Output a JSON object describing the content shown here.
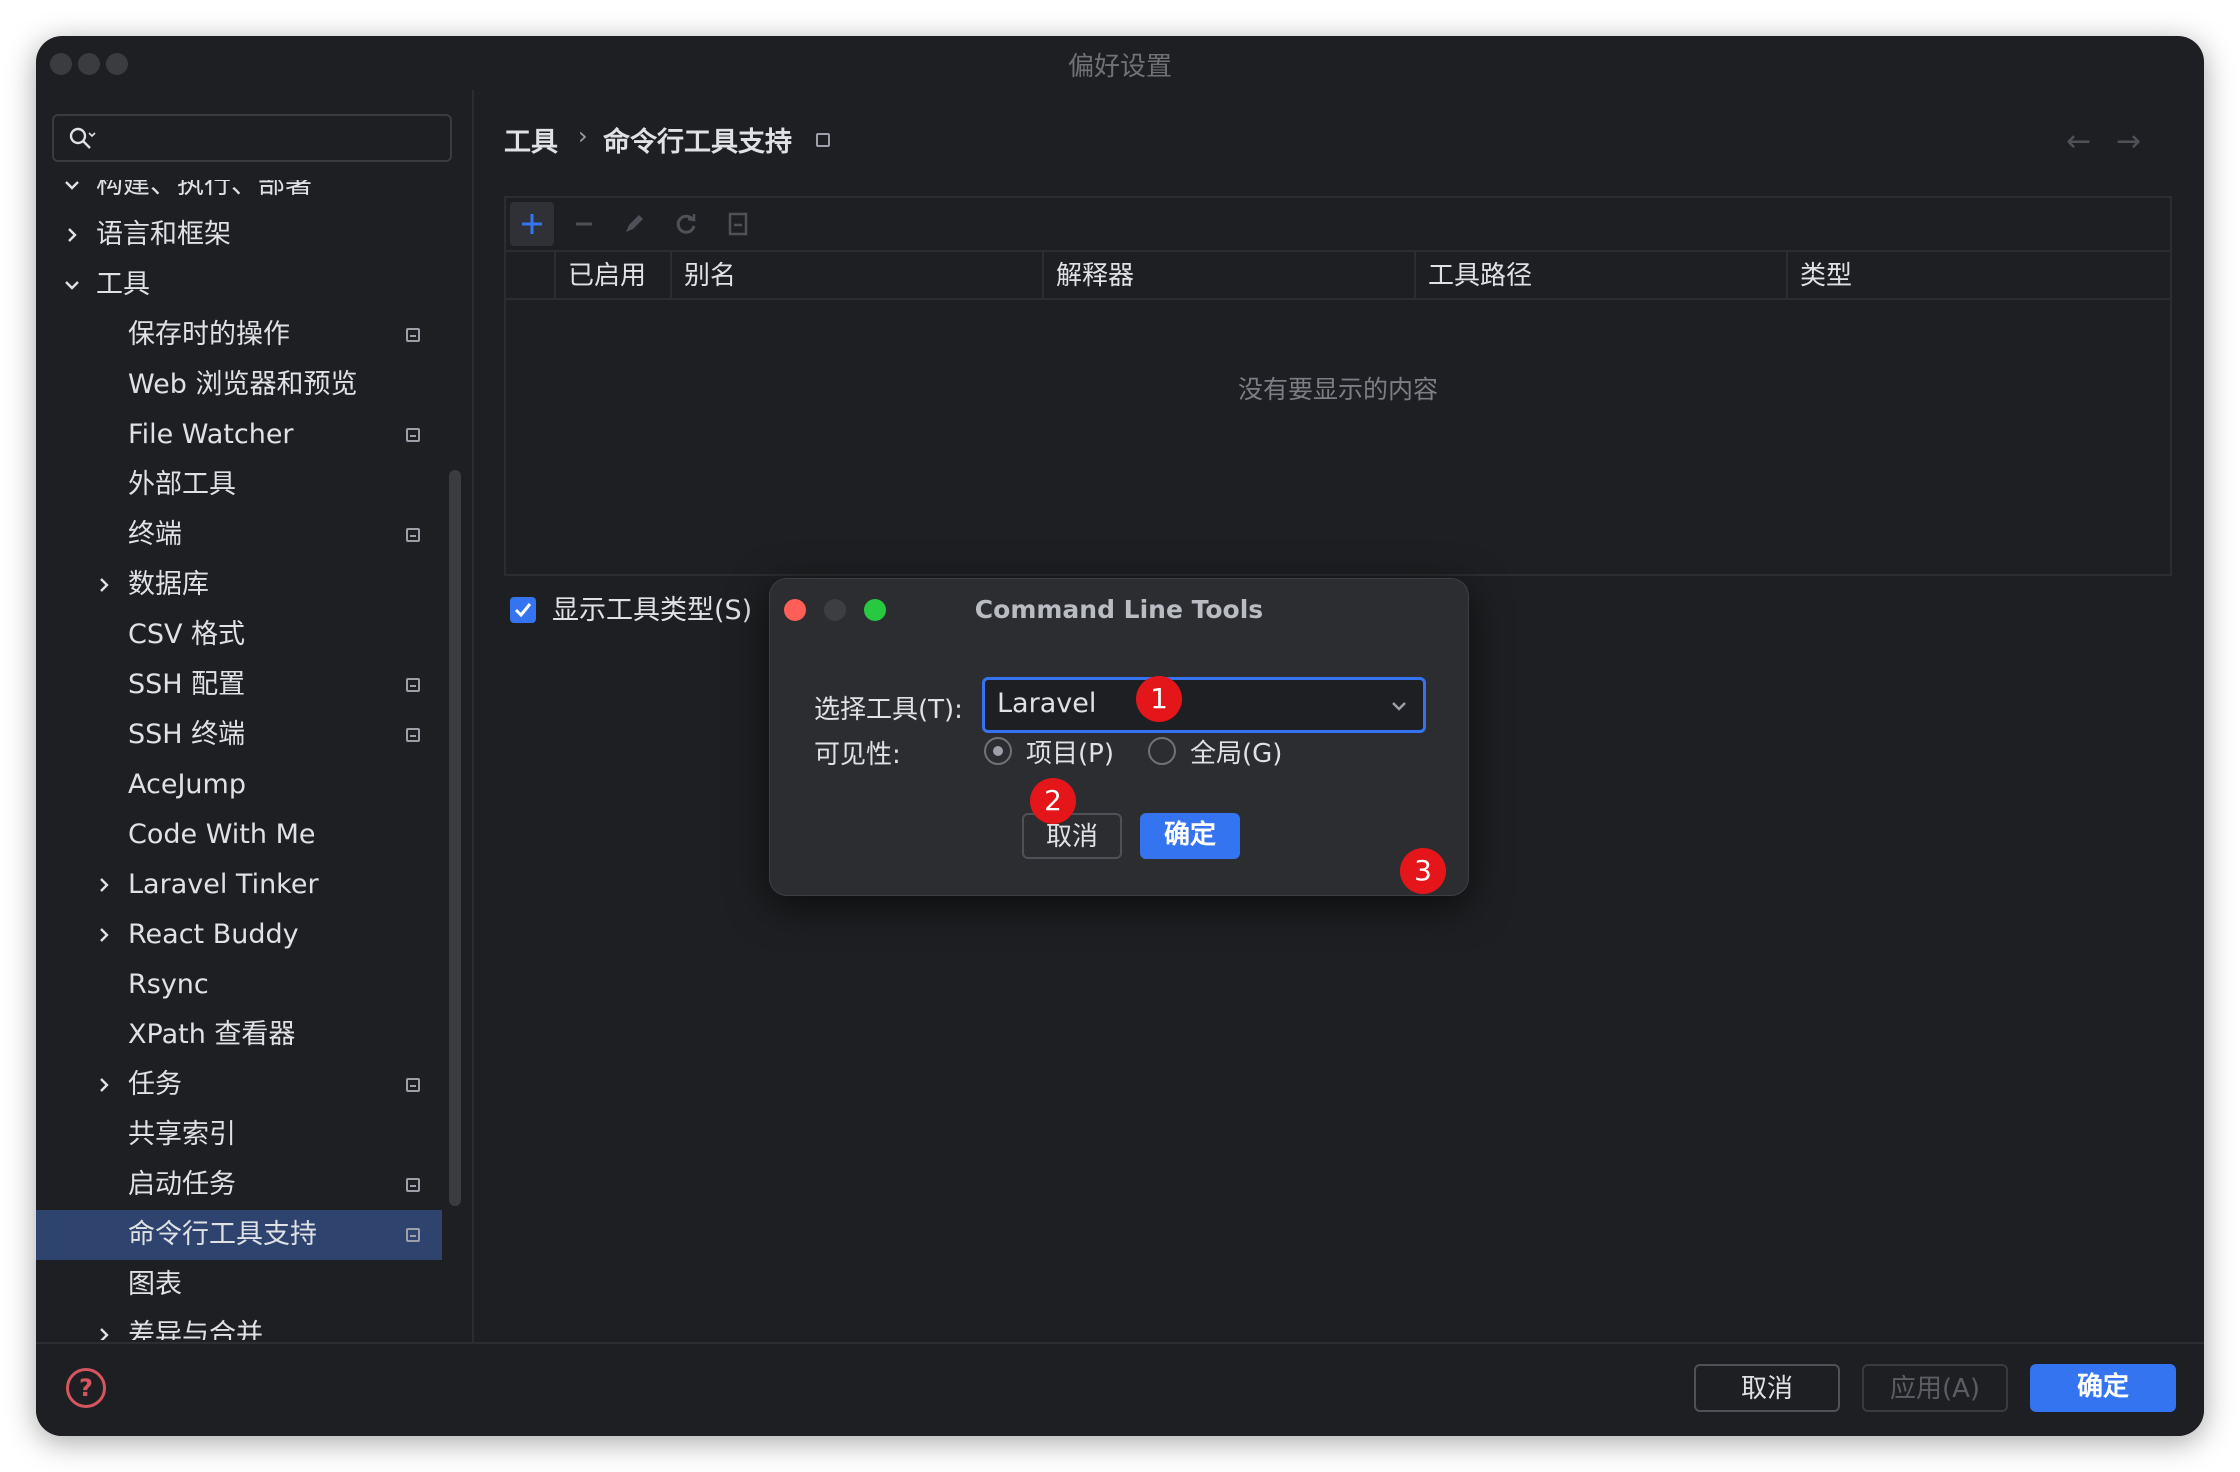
{
  "window": {
    "title": "偏好设置"
  },
  "search": {
    "placeholder": ""
  },
  "sidebar": {
    "items": [
      {
        "label": "构建、执行、部署",
        "level": 0,
        "expander": "expanded",
        "pinned": false
      },
      {
        "label": "语言和框架",
        "level": 0,
        "expander": "collapsed",
        "pinned": false
      },
      {
        "label": "工具",
        "level": 0,
        "expander": "expanded",
        "pinned": false
      },
      {
        "label": "保存时的操作",
        "level": 1,
        "expander": "none",
        "pinned": true
      },
      {
        "label": "Web 浏览器和预览",
        "level": 1,
        "expander": "none",
        "pinned": false
      },
      {
        "label": "File Watcher",
        "level": 1,
        "expander": "none",
        "pinned": true
      },
      {
        "label": "外部工具",
        "level": 1,
        "expander": "none",
        "pinned": false
      },
      {
        "label": "终端",
        "level": 1,
        "expander": "none",
        "pinned": true
      },
      {
        "label": "数据库",
        "level": 1,
        "expander": "collapsed",
        "pinned": false
      },
      {
        "label": "CSV 格式",
        "level": 1,
        "expander": "none",
        "pinned": false
      },
      {
        "label": "SSH 配置",
        "level": 1,
        "expander": "none",
        "pinned": true
      },
      {
        "label": "SSH 终端",
        "level": 1,
        "expander": "none",
        "pinned": true
      },
      {
        "label": "AceJump",
        "level": 1,
        "expander": "none",
        "pinned": false
      },
      {
        "label": "Code With Me",
        "level": 1,
        "expander": "none",
        "pinned": false
      },
      {
        "label": "Laravel Tinker",
        "level": 1,
        "expander": "collapsed",
        "pinned": false
      },
      {
        "label": "React Buddy",
        "level": 1,
        "expander": "collapsed",
        "pinned": false
      },
      {
        "label": "Rsync",
        "level": 1,
        "expander": "none",
        "pinned": false
      },
      {
        "label": "XPath 查看器",
        "level": 1,
        "expander": "none",
        "pinned": false
      },
      {
        "label": "任务",
        "level": 1,
        "expander": "collapsed",
        "pinned": true
      },
      {
        "label": "共享索引",
        "level": 1,
        "expander": "none",
        "pinned": false
      },
      {
        "label": "启动任务",
        "level": 1,
        "expander": "none",
        "pinned": true
      },
      {
        "label": "命令行工具支持",
        "level": 1,
        "expander": "none",
        "pinned": true,
        "selected": true
      },
      {
        "label": "图表",
        "level": 1,
        "expander": "none",
        "pinned": false
      },
      {
        "label": "差异与合并",
        "level": 1,
        "expander": "collapsed",
        "pinned": false
      }
    ]
  },
  "breadcrumb": {
    "parent": "工具",
    "separator": "›",
    "current": "命令行工具支持"
  },
  "toolbar": {
    "icons": [
      "add-icon",
      "remove-icon",
      "edit-icon",
      "refresh-icon",
      "export-icon"
    ]
  },
  "table": {
    "columns": [
      "已启用",
      "别名",
      "解释器",
      "工具路径",
      "类型"
    ],
    "empty_text": "没有要显示的内容"
  },
  "show_tool_type": {
    "label": "显示工具类型(S)",
    "checked": true
  },
  "dialog": {
    "title": "Command Line Tools",
    "tool_label": "选择工具(T):",
    "tool_value": "Laravel",
    "visibility_label": "可见性:",
    "radio_project": "项目(P)",
    "radio_global": "全局(G)",
    "selected_visibility": "project",
    "cancel": "取消",
    "ok": "确定"
  },
  "annotations": [
    "1",
    "2",
    "3"
  ],
  "footer": {
    "help": "?",
    "cancel": "取消",
    "apply": "应用(A)",
    "ok": "确定"
  },
  "colors": {
    "accent": "#3574f0",
    "badge": "#e4161a",
    "selection": "#2e436e",
    "background": "#1e1f22"
  }
}
